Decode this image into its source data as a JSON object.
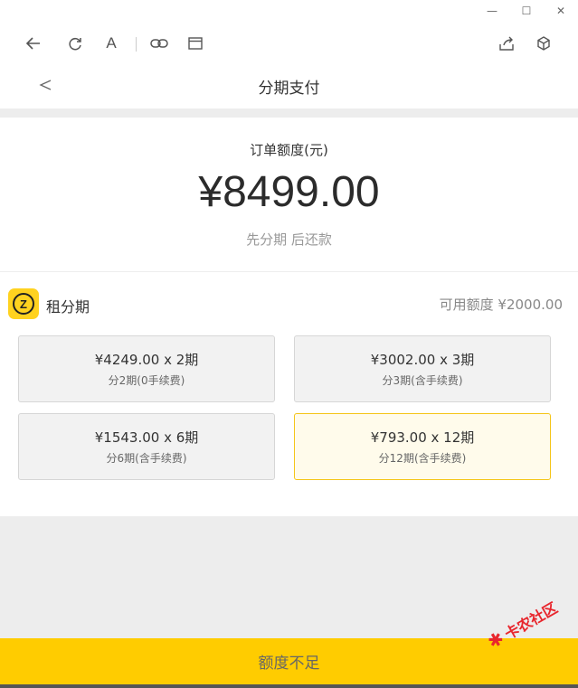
{
  "window": {
    "minimize_glyph": "—",
    "maximize_glyph": "☐",
    "close_glyph": "✕"
  },
  "browser_toolbar": {
    "icons": [
      "back-arrow-icon",
      "refresh-icon",
      "font-icon",
      "link-icon",
      "window-icon",
      "share-icon",
      "cube-icon"
    ],
    "font_glyph": "A"
  },
  "nav": {
    "back_glyph": "<",
    "title": "分期支付"
  },
  "order": {
    "label": "订单额度(元)",
    "amount": "¥8499.00",
    "subtitle": "先分期 后还款"
  },
  "provider": {
    "logo_letter": "Z",
    "name": "租分期",
    "available_credit": "可用额度 ¥2000.00"
  },
  "plans": [
    {
      "main": "¥4249.00 x 2期",
      "sub": "分2期(0手续费)",
      "selected": false
    },
    {
      "main": "¥3002.00 x 3期",
      "sub": "分3期(含手续费)",
      "selected": false
    },
    {
      "main": "¥1543.00 x 6期",
      "sub": "分6期(含手续费)",
      "selected": false
    },
    {
      "main": "¥793.00 x 12期",
      "sub": "分12期(含手续费)",
      "selected": true
    }
  ],
  "bottom_button": {
    "label": "额度不足"
  },
  "watermark": {
    "text": "卡农社区"
  },
  "colors": {
    "accent": "#ffcc00",
    "selected_border": "#f5c518",
    "selected_bg": "#fffbeb",
    "background_gray": "#ededed"
  }
}
